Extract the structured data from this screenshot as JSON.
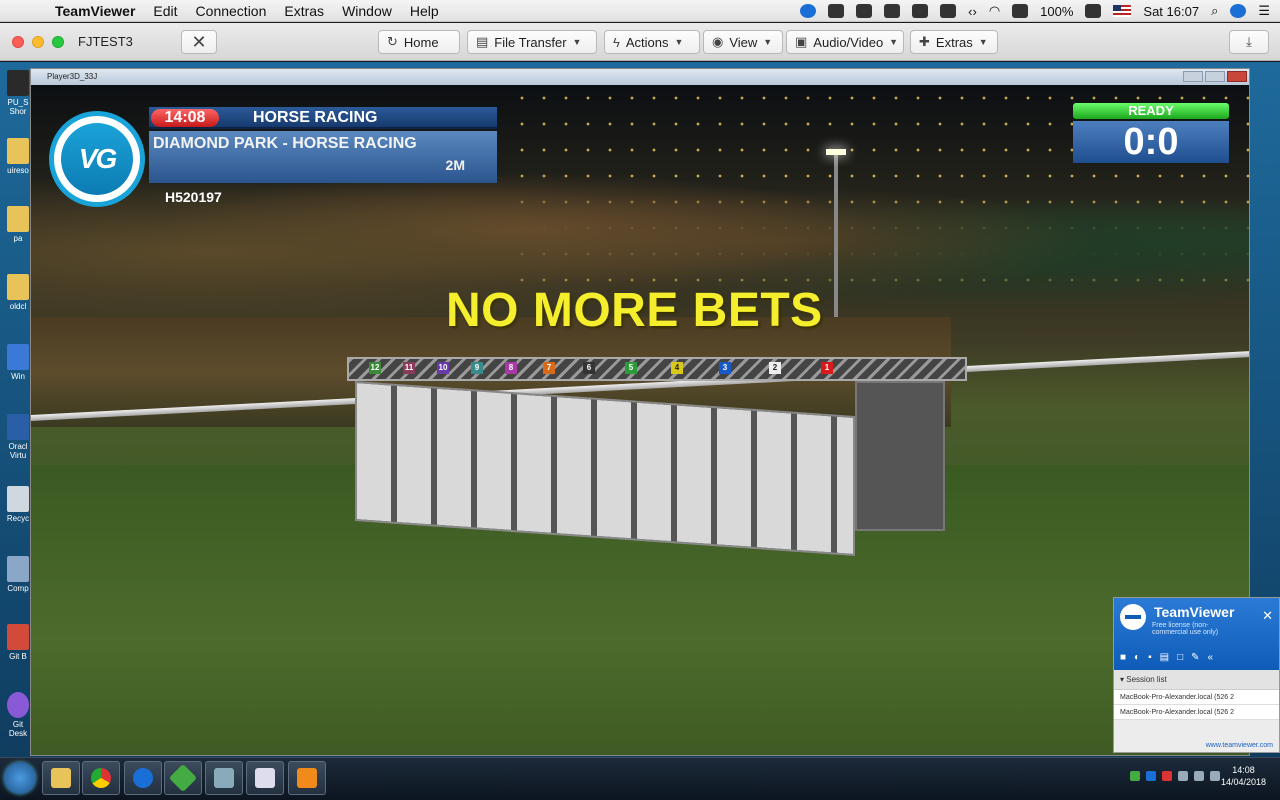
{
  "menubar": {
    "app_name": "TeamViewer",
    "items": [
      "Edit",
      "Connection",
      "Extras",
      "Window",
      "Help"
    ],
    "battery": "100%",
    "clock": "Sat 16:07"
  },
  "tvbar": {
    "session_title": "FJTEST3",
    "home": "Home",
    "file_transfer": "File Transfer",
    "actions": "Actions",
    "view": "View",
    "audio_video": "Audio/Video",
    "extras": "Extras"
  },
  "player": {
    "window_title": "Player3D_33J"
  },
  "race": {
    "time": "14:08",
    "type": "HORSE RACING",
    "track": "DIAMOND PARK - HORSE RACING",
    "distance": "2M",
    "race_id": "H520197",
    "status": "READY",
    "score": "0:0",
    "banner": "NO MORE BETS",
    "logo_text": "VG",
    "gate_numbers": [
      "12",
      "11",
      "10",
      "9",
      "8",
      "7",
      "6",
      "5",
      "4",
      "3",
      "2",
      "1"
    ]
  },
  "desktop_icons": [
    "PU_S Shor",
    "uireso",
    "pa",
    "oldcl",
    "Win",
    "Oracl Virtu",
    "Recyc",
    "Comp",
    "Git B",
    "Git Desk"
  ],
  "tv_panel": {
    "name": "TeamViewer",
    "license": "Free license (non-commercial use only)",
    "session_list": "Session list",
    "sessions": [
      "MacBook-Pro-Alexander.local (526 2",
      "MacBook-Pro-Alexander.local (526 2"
    ],
    "link": "www.teamviewer.com"
  },
  "taskbar": {
    "time": "14:08",
    "date": "14/04/2018"
  },
  "colors": {
    "banner": "#f4ee2c",
    "ready": "#1ca61c",
    "timer": "#c61a1a",
    "brand": "#1aa3d8"
  }
}
